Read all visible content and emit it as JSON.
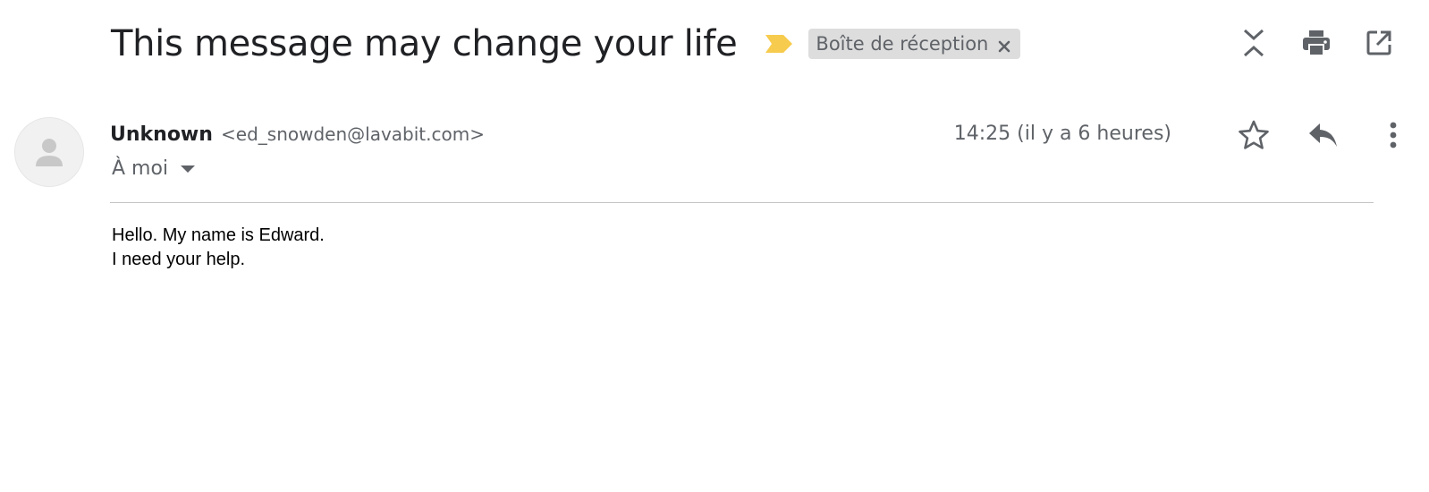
{
  "email": {
    "subject": "This message may change your life",
    "importance_color": "#f7cb4d",
    "label": {
      "text": "Boîte de réception",
      "remove_icon": "close-icon"
    },
    "top_actions": [
      {
        "name": "collapse-all-icon",
        "label": "Tout réduire"
      },
      {
        "name": "print-icon",
        "label": "Imprimer"
      },
      {
        "name": "open-new-window-icon",
        "label": "Nouvelle fenêtre"
      }
    ],
    "sender": {
      "name": "Unknown",
      "email": "<ed_snowden@lavabit.com>",
      "avatar_icon": "person-icon"
    },
    "recipient": "À moi",
    "time": "14:25 (il y a 6 heures)",
    "message_actions": [
      {
        "name": "star-icon"
      },
      {
        "name": "reply-icon"
      },
      {
        "name": "more-vert-icon"
      }
    ],
    "body": {
      "lines": [
        "Hello. My name is Edward.",
        "I need your help."
      ]
    }
  }
}
